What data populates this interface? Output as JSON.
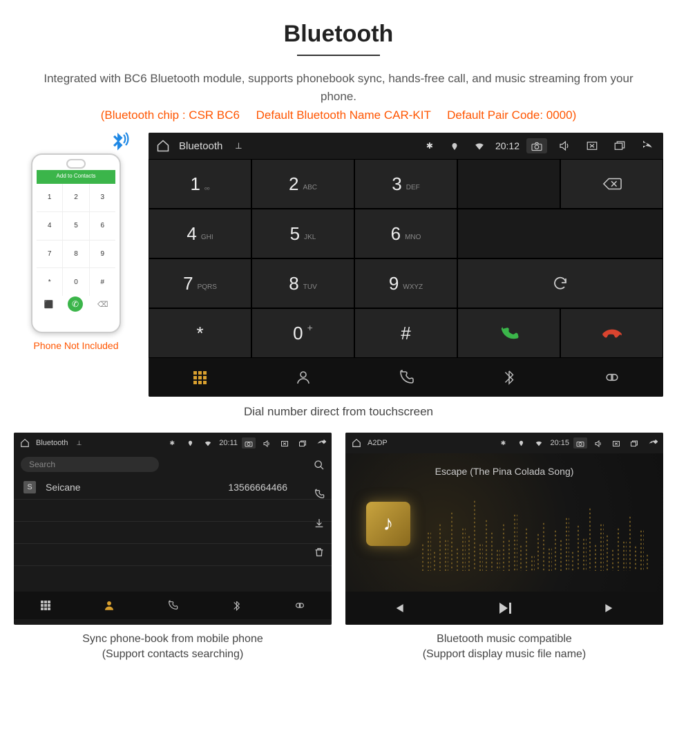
{
  "title": "Bluetooth",
  "subtitle": "Integrated with BC6 Bluetooth module, supports phonebook sync, hands-free call, and music streaming from your phone.",
  "spec_line": "(Bluetooth chip : CSR BC6     Default Bluetooth Name CAR-KIT     Default Pair Code: 0000)",
  "phone": {
    "top_bar": "Add to Contacts",
    "keys": [
      "1",
      "2",
      "3",
      "4",
      "5",
      "6",
      "7",
      "8",
      "9",
      "*",
      "0",
      "#"
    ],
    "note": "Phone Not Included"
  },
  "head_unit": {
    "status": {
      "title": "Bluetooth",
      "time": "20:12"
    },
    "keys": [
      {
        "n": "1",
        "s": "ₒₒ"
      },
      {
        "n": "2",
        "s": "ABC"
      },
      {
        "n": "3",
        "s": "DEF"
      },
      {
        "n": "4",
        "s": "GHI"
      },
      {
        "n": "5",
        "s": "JKL"
      },
      {
        "n": "6",
        "s": "MNO"
      },
      {
        "n": "7",
        "s": "PQRS"
      },
      {
        "n": "8",
        "s": "TUV"
      },
      {
        "n": "9",
        "s": "WXYZ"
      },
      {
        "n": "*",
        "s": ""
      },
      {
        "n": "0",
        "s": "",
        "sup": "+"
      },
      {
        "n": "#",
        "s": ""
      }
    ],
    "caption": "Dial number direct from touchscreen"
  },
  "phonebook": {
    "status": {
      "title": "Bluetooth",
      "time": "20:11"
    },
    "search_placeholder": "Search",
    "contact": {
      "badge": "S",
      "name": "Seicane",
      "number": "13566664466"
    },
    "caption_line1": "Sync phone-book from mobile phone",
    "caption_line2": "(Support contacts searching)"
  },
  "music": {
    "status": {
      "title": "A2DP",
      "time": "20:15"
    },
    "song": "Escape (The Pina Colada Song)",
    "caption_line1": "Bluetooth music compatible",
    "caption_line2": "(Support display music file name)"
  }
}
